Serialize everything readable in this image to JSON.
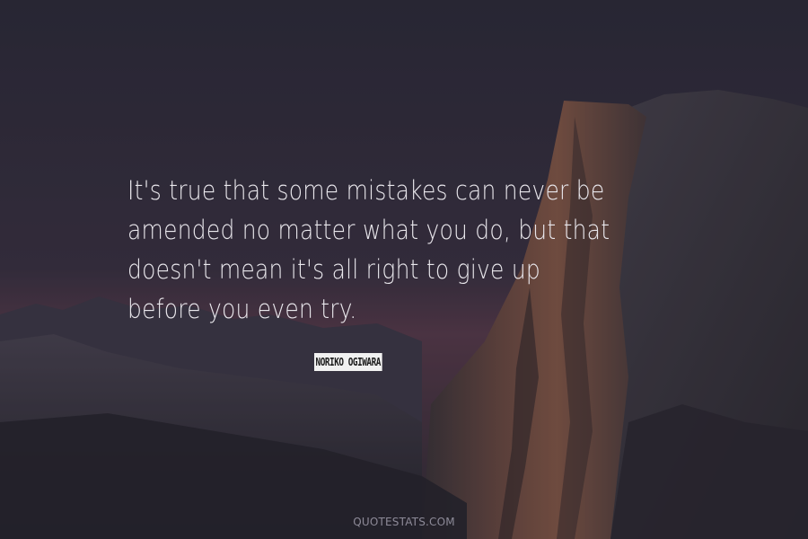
{
  "quote": {
    "lines": [
      "It's true that some mistakes can never be",
      "amended no matter what you do, but that",
      "doesn't mean it's all right to give up",
      "before you even try."
    ]
  },
  "author": "NORIKO OGIWARA",
  "watermark": "QUOTESTATS.COM",
  "background": {
    "scene": "mountain-cliff-dusk",
    "colors": {
      "sky": "#2d2c3b",
      "rock": "#3c3a44",
      "rock_warm": "#7a5548",
      "horizon_glow": "#5a3c4c"
    }
  }
}
